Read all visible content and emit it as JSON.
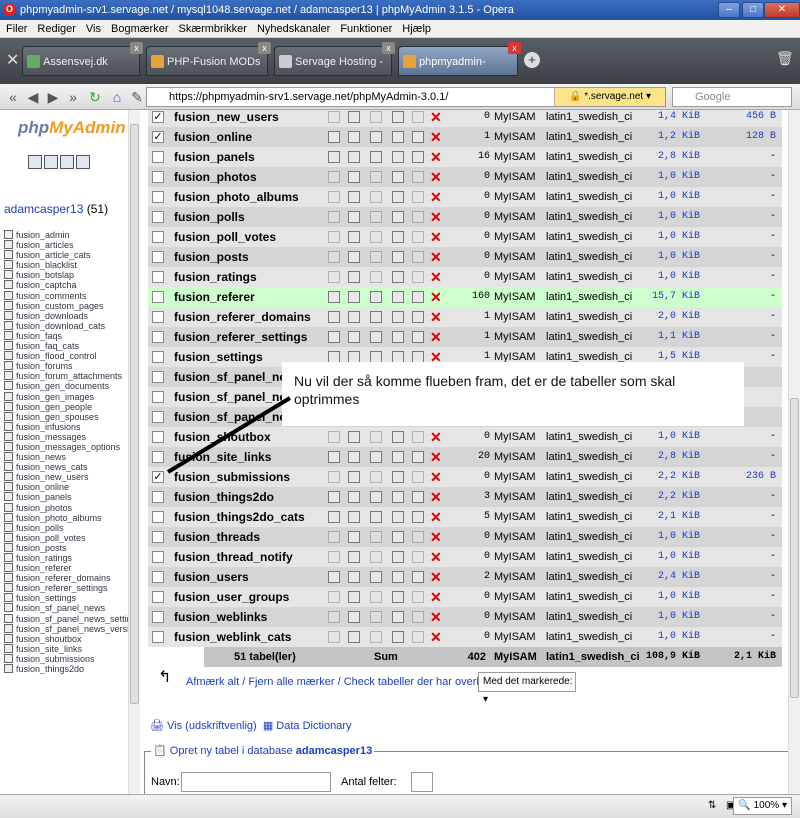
{
  "window": {
    "title": "phpmyadmin-srv1.servage.net / mysql1048.servage.net / adamcasper13 | phpMyAdmin 3.1.5 - Opera"
  },
  "menu": [
    "Filer",
    "Rediger",
    "Vis",
    "Bogmærker",
    "Skærmbrikker",
    "Nyhedskanaler",
    "Funktioner",
    "Hjælp"
  ],
  "tabs": [
    {
      "label": "Assensvej.dk",
      "active": false
    },
    {
      "label": "PHP-Fusion MODs & I...",
      "active": false
    },
    {
      "label": "Servage Hosting - MyS...",
      "active": false
    },
    {
      "label": "phpmyadmin-srv1.ser...",
      "active": true
    }
  ],
  "nav": {
    "url": "https://phpmyadmin-srv1.servage.net/phpMyAdmin-3.0.1/",
    "security": "*.servage.net",
    "search_placeholder": "Google"
  },
  "sidebar": {
    "logo_php": "php",
    "logo_my": "MyAdmin",
    "db_name": "adamcasper13",
    "db_count": "(51)",
    "tables": [
      "fusion_admin",
      "fusion_articles",
      "fusion_article_cats",
      "fusion_blacklist",
      "fusion_botslap",
      "fusion_captcha",
      "fusion_comments",
      "fusion_custom_pages",
      "fusion_downloads",
      "fusion_download_cats",
      "fusion_faqs",
      "fusion_faq_cats",
      "fusion_flood_control",
      "fusion_forums",
      "fusion_forum_attachments",
      "fusion_gen_documents",
      "fusion_gen_images",
      "fusion_gen_people",
      "fusion_gen_spouses",
      "fusion_infusions",
      "fusion_messages",
      "fusion_messages_options",
      "fusion_news",
      "fusion_news_cats",
      "fusion_new_users",
      "fusion_online",
      "fusion_panels",
      "fusion_photos",
      "fusion_photo_albums",
      "fusion_polls",
      "fusion_poll_votes",
      "fusion_posts",
      "fusion_ratings",
      "fusion_referer",
      "fusion_referer_domains",
      "fusion_referer_settings",
      "fusion_settings",
      "fusion_sf_panel_news",
      "fusion_sf_panel_news_settings",
      "fusion_sf_panel_news_version",
      "fusion_shoutbox",
      "fusion_site_links",
      "fusion_submissions",
      "fusion_things2do"
    ]
  },
  "rows": [
    {
      "name": "fusion_new_users",
      "checked": true,
      "rows": "0",
      "engine": "MyISAM",
      "collation": "latin1_swedish_ci",
      "size": "1,4 KiB",
      "overhead": "456 B",
      "empty": true
    },
    {
      "name": "fusion_online",
      "checked": true,
      "rows": "1",
      "engine": "MyISAM",
      "collation": "latin1_swedish_ci",
      "size": "1,2 KiB",
      "overhead": "128 B",
      "empty": false
    },
    {
      "name": "fusion_panels",
      "checked": false,
      "rows": "16",
      "engine": "MyISAM",
      "collation": "latin1_swedish_ci",
      "size": "2,8 KiB",
      "overhead": "-",
      "empty": false
    },
    {
      "name": "fusion_photos",
      "checked": false,
      "rows": "0",
      "engine": "MyISAM",
      "collation": "latin1_swedish_ci",
      "size": "1,0 KiB",
      "overhead": "-",
      "empty": true
    },
    {
      "name": "fusion_photo_albums",
      "checked": false,
      "rows": "0",
      "engine": "MyISAM",
      "collation": "latin1_swedish_ci",
      "size": "1,0 KiB",
      "overhead": "-",
      "empty": true
    },
    {
      "name": "fusion_polls",
      "checked": false,
      "rows": "0",
      "engine": "MyISAM",
      "collation": "latin1_swedish_ci",
      "size": "1,0 KiB",
      "overhead": "-",
      "empty": true
    },
    {
      "name": "fusion_poll_votes",
      "checked": false,
      "rows": "0",
      "engine": "MyISAM",
      "collation": "latin1_swedish_ci",
      "size": "1,0 KiB",
      "overhead": "-",
      "empty": true
    },
    {
      "name": "fusion_posts",
      "checked": false,
      "rows": "0",
      "engine": "MyISAM",
      "collation": "latin1_swedish_ci",
      "size": "1,0 KiB",
      "overhead": "-",
      "empty": true
    },
    {
      "name": "fusion_ratings",
      "checked": false,
      "rows": "0",
      "engine": "MyISAM",
      "collation": "latin1_swedish_ci",
      "size": "1,0 KiB",
      "overhead": "-",
      "empty": true
    },
    {
      "name": "fusion_referer",
      "checked": false,
      "rows": "160",
      "engine": "MyISAM",
      "collation": "latin1_swedish_ci",
      "size": "15,7 KiB",
      "overhead": "-",
      "empty": false,
      "highlight": true
    },
    {
      "name": "fusion_referer_domains",
      "checked": false,
      "rows": "1",
      "engine": "MyISAM",
      "collation": "latin1_swedish_ci",
      "size": "2,0 KiB",
      "overhead": "-",
      "empty": false
    },
    {
      "name": "fusion_referer_settings",
      "checked": false,
      "rows": "1",
      "engine": "MyISAM",
      "collation": "latin1_swedish_ci",
      "size": "1,1 KiB",
      "overhead": "-",
      "empty": false
    },
    {
      "name": "fusion_settings",
      "checked": false,
      "rows": "1",
      "engine": "MyISAM",
      "collation": "latin1_swedish_ci",
      "size": "1,5 KiB",
      "overhead": "-",
      "empty": false
    },
    {
      "name": "fusion_sf_panel_news",
      "checked": false,
      "rows": "",
      "engine": "",
      "collation": "",
      "size": "",
      "overhead": "",
      "empty": false
    },
    {
      "name": "fusion_sf_panel_news_se",
      "checked": false,
      "rows": "",
      "engine": "",
      "collation": "",
      "size": "",
      "overhead": "",
      "empty": false
    },
    {
      "name": "fusion_sf_panel_news_ver",
      "checked": false,
      "rows": "",
      "engine": "",
      "collation": "",
      "size": "",
      "overhead": "",
      "empty": false
    },
    {
      "name": "fusion_shoutbox",
      "checked": false,
      "rows": "0",
      "engine": "MyISAM",
      "collation": "latin1_swedish_ci",
      "size": "1,0 KiB",
      "overhead": "-",
      "empty": true
    },
    {
      "name": "fusion_site_links",
      "checked": false,
      "rows": "20",
      "engine": "MyISAM",
      "collation": "latin1_swedish_ci",
      "size": "2,8 KiB",
      "overhead": "-",
      "empty": false
    },
    {
      "name": "fusion_submissions",
      "checked": true,
      "rows": "0",
      "engine": "MyISAM",
      "collation": "latin1_swedish_ci",
      "size": "2,2 KiB",
      "overhead": "236 B",
      "empty": true
    },
    {
      "name": "fusion_things2do",
      "checked": false,
      "rows": "3",
      "engine": "MyISAM",
      "collation": "latin1_swedish_ci",
      "size": "2,2 KiB",
      "overhead": "-",
      "empty": false
    },
    {
      "name": "fusion_things2do_cats",
      "checked": false,
      "rows": "5",
      "engine": "MyISAM",
      "collation": "latin1_swedish_ci",
      "size": "2,1 KiB",
      "overhead": "-",
      "empty": false
    },
    {
      "name": "fusion_threads",
      "checked": false,
      "rows": "0",
      "engine": "MyISAM",
      "collation": "latin1_swedish_ci",
      "size": "1,0 KiB",
      "overhead": "-",
      "empty": true
    },
    {
      "name": "fusion_thread_notify",
      "checked": false,
      "rows": "0",
      "engine": "MyISAM",
      "collation": "latin1_swedish_ci",
      "size": "1,0 KiB",
      "overhead": "-",
      "empty": true
    },
    {
      "name": "fusion_users",
      "checked": false,
      "rows": "2",
      "engine": "MyISAM",
      "collation": "latin1_swedish_ci",
      "size": "2,4 KiB",
      "overhead": "-",
      "empty": false
    },
    {
      "name": "fusion_user_groups",
      "checked": false,
      "rows": "0",
      "engine": "MyISAM",
      "collation": "latin1_swedish_ci",
      "size": "1,0 KiB",
      "overhead": "-",
      "empty": true
    },
    {
      "name": "fusion_weblinks",
      "checked": false,
      "rows": "0",
      "engine": "MyISAM",
      "collation": "latin1_swedish_ci",
      "size": "1,0 KiB",
      "overhead": "-",
      "empty": true
    },
    {
      "name": "fusion_weblink_cats",
      "checked": false,
      "rows": "0",
      "engine": "MyISAM",
      "collation": "latin1_swedish_ci",
      "size": "1,0 KiB",
      "overhead": "-",
      "empty": true
    }
  ],
  "summary": {
    "tables": "51 tabel(ler)",
    "label": "Sum",
    "rows": "402",
    "engine": "MyISAM",
    "collation": "latin1_swedish_ci",
    "size": "108,9 KiB",
    "overhead": "2,1 KiB"
  },
  "check_links": "Afmærk alt / Fjern alle mærker / Check tabeller der har overhead",
  "with_selected": "Med det markerede:",
  "print_link": "Vis (udskriftvenlig)",
  "dict_link": "Data Dictionary",
  "new_table": {
    "legend": "Opret ny tabel i database",
    "db": "adamcasper13",
    "name_label": "Navn:",
    "fields_label": "Antal felter:"
  },
  "annotation": "Nu vil der så komme flueben fram, det er de tabeller som skal optrimmes",
  "status": {
    "zoom": "100%"
  },
  "colors": {
    "title_bar": "#2c5fb4",
    "highlight_row": "#ccffcc",
    "link": "#1b3dc6",
    "delete": "#dd0000"
  }
}
